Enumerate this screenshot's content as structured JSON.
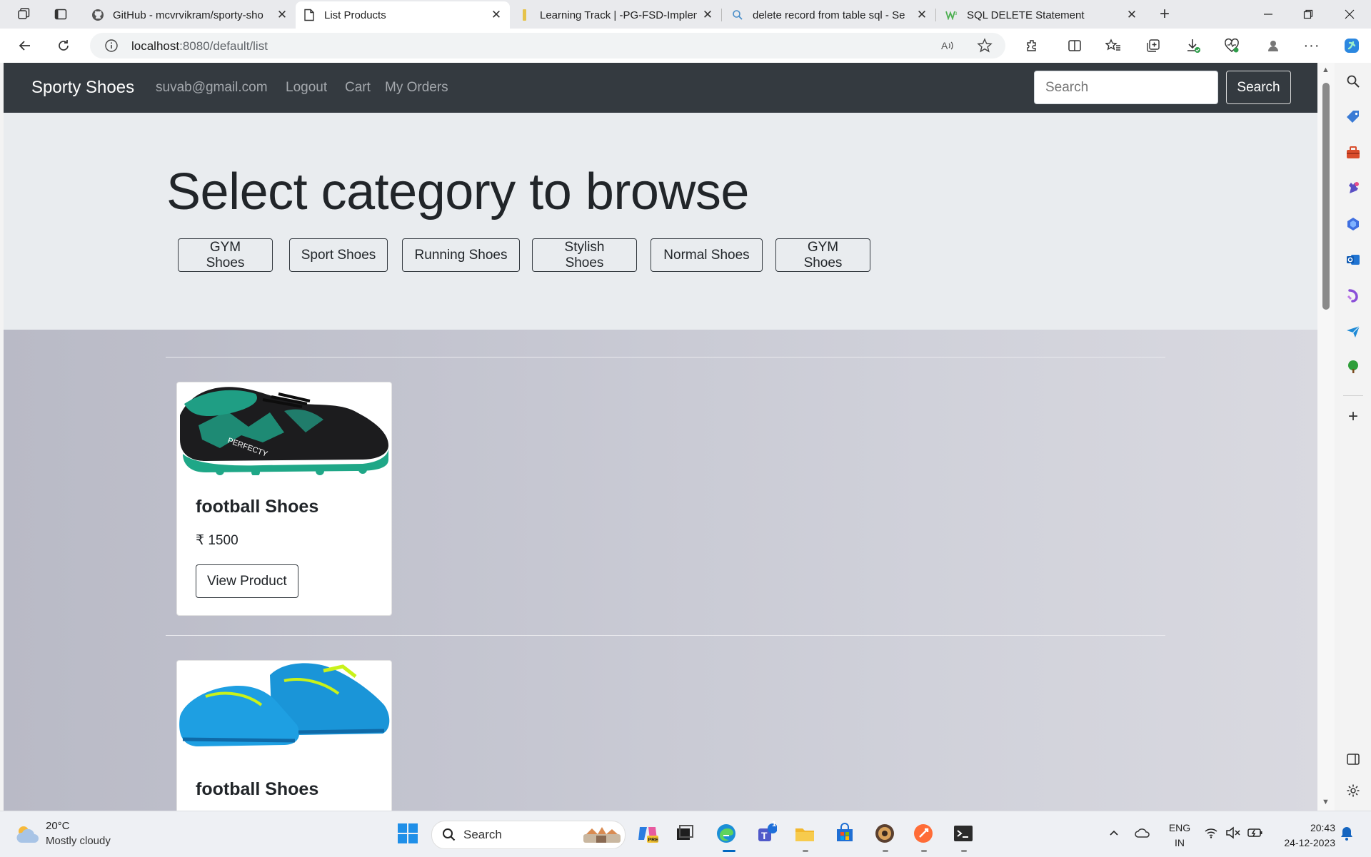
{
  "browser": {
    "tabs": [
      {
        "title": "GitHub - mcvrvikram/sporty-sho",
        "icon": "github-icon",
        "active": false
      },
      {
        "title": "List Products",
        "icon": "page-icon",
        "active": true
      },
      {
        "title": "Learning Track | -PG-FSD-Implem",
        "icon": "learning-icon",
        "active": false
      },
      {
        "title": "delete record from table sql - Se",
        "icon": "search-icon",
        "active": false
      },
      {
        "title": "SQL DELETE Statement",
        "icon": "w3-icon",
        "active": false
      }
    ],
    "url_host": "localhost",
    "url_path": ":8080/default/list"
  },
  "navbar": {
    "brand": "Sporty Shoes",
    "links": [
      "suvab@gmail.com",
      "Logout",
      "Cart",
      "My Orders"
    ],
    "search_placeholder": "Search",
    "search_button": "Search"
  },
  "jumbotron": {
    "heading": "Select category to browse",
    "categories": [
      "GYM Shoes",
      "Sport Shoes",
      "Running Shoes",
      "Stylish Shoes",
      "Normal Shoes",
      "GYM Shoes"
    ]
  },
  "products": [
    {
      "name": "football Shoes",
      "price": "₹ 1500",
      "button": "View Product",
      "image": "black-green-football-shoe"
    },
    {
      "name": "football Shoes",
      "image": "blue-football-shoes"
    }
  ],
  "taskbar": {
    "weather_temp": "20°C",
    "weather_desc": "Mostly cloudy",
    "search_label": "Search",
    "language_line1": "ENG",
    "language_line2": "IN",
    "time": "20:43",
    "date": "24-12-2023",
    "teams_badge": "1"
  },
  "colors": {
    "navbar": "#343a40",
    "jumbotron": "#e9ecef",
    "accent_blue": "#0067c0"
  }
}
